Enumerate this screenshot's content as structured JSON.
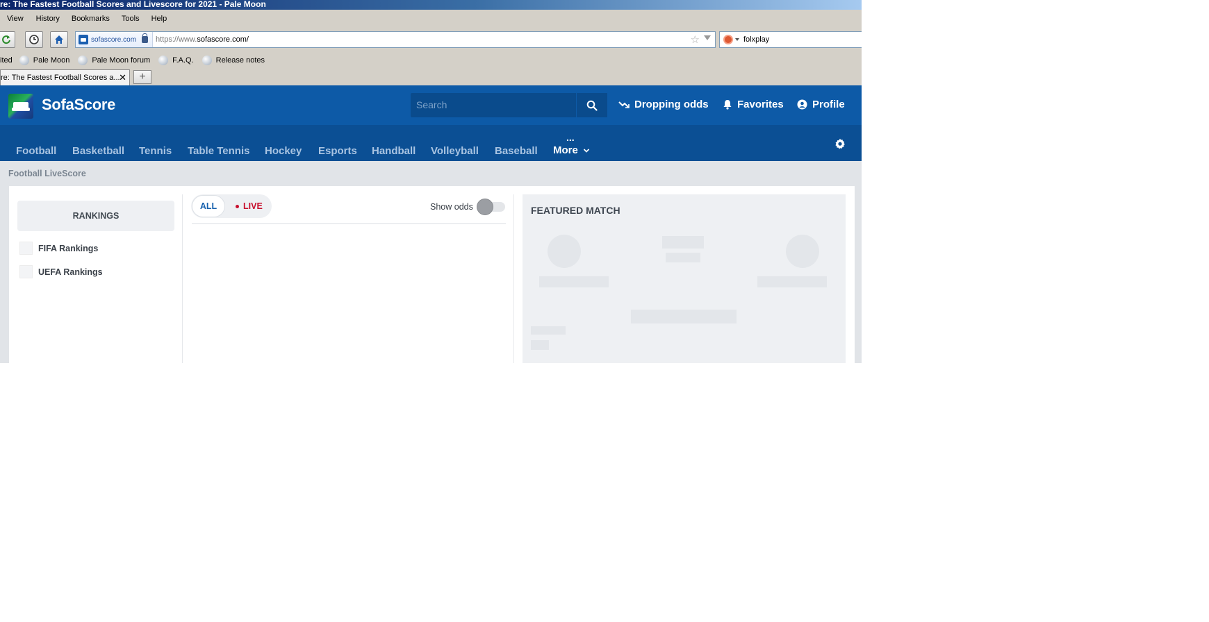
{
  "window": {
    "title": "re: The Fastest Football Scores and Livescore for 2021 - Pale Moon"
  },
  "menu": {
    "items": [
      "View",
      "History",
      "Bookmarks",
      "Tools",
      "Help"
    ]
  },
  "url_bar": {
    "identity": "sofascore.com",
    "url_prefix": "https://www.",
    "url_domain": "sofascore.com/"
  },
  "search_bar": {
    "value": "folxplay"
  },
  "bookmarks": {
    "items": [
      "ited",
      "Pale Moon",
      "Pale Moon forum",
      "F.A.Q.",
      "Release notes"
    ]
  },
  "tab": {
    "title": "re: The Fastest Football Scores a...",
    "close": "✕",
    "new_tab": "+"
  },
  "site": {
    "brand": "SofaScore",
    "search_placeholder": "Search",
    "nav": {
      "dropping_odds": "Dropping odds",
      "favorites": "Favorites",
      "profile": "Profile"
    },
    "sports": [
      "Football",
      "Basketball",
      "Tennis",
      "Table Tennis",
      "Hockey",
      "Esports",
      "Handball",
      "Volleyball",
      "Baseball"
    ],
    "more_label": "More",
    "more_dots": "..."
  },
  "breadcrumb": "Football LiveScore",
  "rankings": {
    "heading": "RANKINGS",
    "items": [
      "FIFA Rankings",
      "UEFA Rankings"
    ]
  },
  "filters": {
    "all": "ALL",
    "live": "LIVE",
    "show_odds": "Show odds",
    "show_odds_enabled": false
  },
  "featured": {
    "title": "FEATURED MATCH"
  },
  "colors": {
    "header_blue": "#0d5aa7",
    "nav_blue": "#0b4f94",
    "live_red": "#c8102e",
    "link_blue": "#1761ae"
  }
}
